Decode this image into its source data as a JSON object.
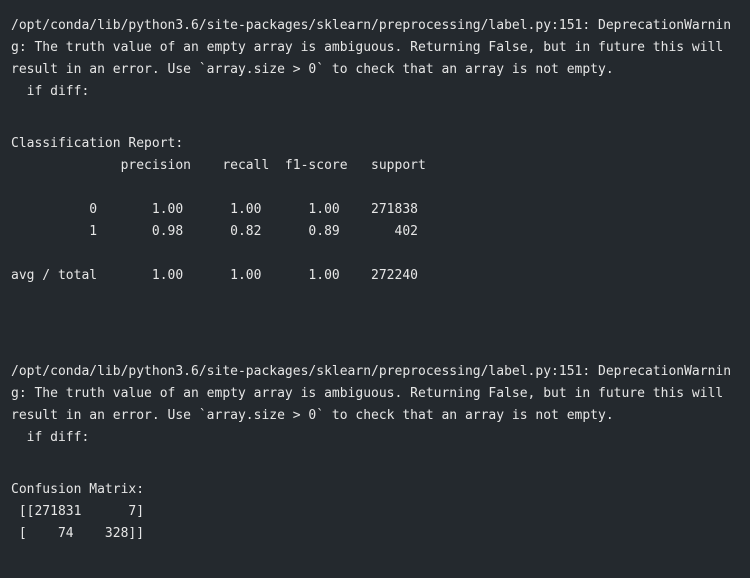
{
  "output": {
    "warning_1": [
      "/opt/conda/lib/python3.6/site-packages/sklearn/preprocessing/label.py:151: DeprecationWarnin",
      "g: The truth value of an empty array is ambiguous. Returning False, but in future this will",
      "result in an error. Use `array.size > 0` to check that an array is not empty.",
      "  if diff:"
    ],
    "report": [
      "Classification Report:",
      "              precision    recall  f1-score   support",
      "",
      "          0       1.00      1.00      1.00    271838",
      "          1       0.98      0.82      0.89       402",
      "",
      "avg / total       1.00      1.00      1.00    272240"
    ],
    "warning_2": [
      "/opt/conda/lib/python3.6/site-packages/sklearn/preprocessing/label.py:151: DeprecationWarnin",
      "g: The truth value of an empty array is ambiguous. Returning False, but in future this will",
      "result in an error. Use `array.size > 0` to check that an array is not empty.",
      "  if diff:"
    ],
    "confusion": [
      "Confusion Matrix:",
      " [[271831      7]",
      " [    74    328]]"
    ]
  },
  "colors": {
    "background": "#24292e",
    "text": "#e6e6e6"
  }
}
